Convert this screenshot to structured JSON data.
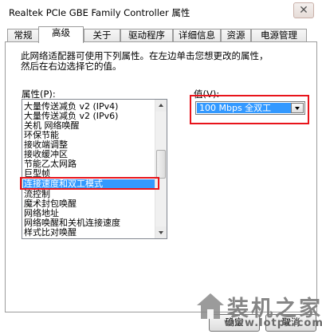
{
  "window": {
    "title": "Realtek PCIe GBE Family Controller 属性",
    "close_glyph": "✕"
  },
  "tabs": [
    {
      "label": "常规"
    },
    {
      "label": "高级"
    },
    {
      "label": "关于"
    },
    {
      "label": "驱动程序"
    },
    {
      "label": "详细信息"
    },
    {
      "label": "资源"
    },
    {
      "label": "电源管理"
    }
  ],
  "active_tab": "高级",
  "description": {
    "line1": "此网络适配器可使用下列属性。在左边单击您想更改的属性，",
    "line2": "然后在右边选择它的值。"
  },
  "properties": {
    "label": "属性(P):",
    "items": [
      {
        "label": "大量传送减负 v2 (IPv4)"
      },
      {
        "label": "大量传送减负 v2 (IPv6)"
      },
      {
        "label": "关机 网络唤醒"
      },
      {
        "label": "环保节能"
      },
      {
        "label": "接收端调整"
      },
      {
        "label": "接收缓冲区"
      },
      {
        "label": "节能乙太网路"
      },
      {
        "label": "巨型帧"
      },
      {
        "label": "连接速度和双工模式"
      },
      {
        "label": "流控制"
      },
      {
        "label": "魔术封包唤醒"
      },
      {
        "label": "网络地址"
      },
      {
        "label": "网络唤醒和关机连接速度"
      },
      {
        "label": "样式比对唤醒"
      }
    ],
    "selected": "连接速度和双工模式"
  },
  "value": {
    "label": "值(V):",
    "selected": "100 Mbps 全双工"
  },
  "buttons": {
    "ok": "确定",
    "cancel": "取消"
  },
  "watermark": {
    "text": "装机之家",
    "url": "www.lotpc.com"
  },
  "colors": {
    "selection": "#3399ff",
    "highlight_box": "#e8141b"
  }
}
